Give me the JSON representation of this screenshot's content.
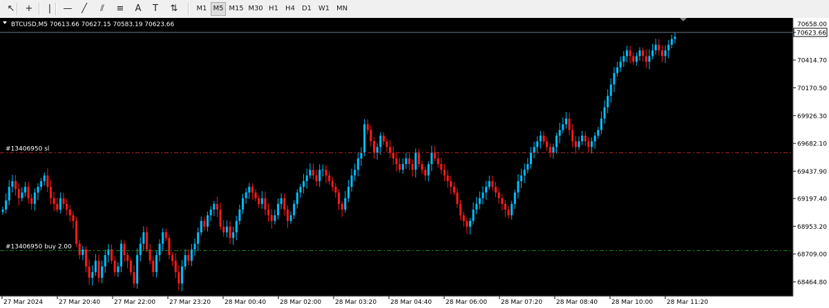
{
  "toolbar": {
    "tools": [
      {
        "name": "cursor-icon",
        "glyph": "↖"
      },
      {
        "name": "crosshair-icon",
        "glyph": "+"
      },
      {
        "name": "vertical-line-icon",
        "glyph": "|"
      },
      {
        "name": "horizontal-line-icon",
        "glyph": "—"
      },
      {
        "name": "trendline-icon",
        "glyph": "╱"
      },
      {
        "name": "equidistant-channel-icon",
        "glyph": "⫽"
      },
      {
        "name": "fibonacci-icon",
        "glyph": "≡"
      },
      {
        "name": "text-icon",
        "glyph": "A"
      },
      {
        "name": "text-label-icon",
        "glyph": "T"
      },
      {
        "name": "arrows-icon",
        "glyph": "⇅"
      }
    ],
    "timeframes": [
      "M1",
      "M5",
      "M15",
      "M30",
      "H1",
      "H4",
      "D1",
      "W1",
      "MN"
    ],
    "active_timeframe": "M5"
  },
  "chart": {
    "info": "BTCUSD,M5  70613.66 70627.15 70583.19 70623.66",
    "symbol": "BTCUSD",
    "timeframe": "M5",
    "current_price_label": "70623.66",
    "top_price_label": "70658.00",
    "sl_label": "#13406950 sl",
    "buy_label": "#13406950 buy 2.00",
    "colors": {
      "background": "#000000",
      "bull": "#00bfff",
      "bear": "#ff1a1a",
      "sl_line": "#b22222",
      "buy_line": "#228b22",
      "grid_text": "#000000",
      "axis_bg": "#ffffff"
    }
  },
  "chart_data": {
    "type": "candlestick",
    "symbol": "BTCUSD",
    "timeframe": "M5",
    "ohlc_last": {
      "open": 70613.66,
      "high": 70627.15,
      "low": 70583.19,
      "close": 70623.66
    },
    "y_ticks": [
      70658.0,
      70414.7,
      70170.5,
      69926.3,
      69682.1,
      69437.9,
      69197.4,
      68953.2,
      68709.0,
      68464.8
    ],
    "y_tick_labels": [
      "70658.00",
      "70414.70",
      "70170.50",
      "69926.30",
      "69682.10",
      "69437.90",
      "69197.40",
      "68953.20",
      "68709.00",
      "68464.80"
    ],
    "x_tick_labels": [
      "27 Mar 2024",
      "27 Mar 20:40",
      "27 Mar 22:00",
      "27 Mar 23:20",
      "28 Mar 00:40",
      "28 Mar 02:00",
      "28 Mar 03:20",
      "28 Mar 04:40",
      "28 Mar 06:00",
      "28 Mar 07:20",
      "28 Mar 08:40",
      "28 Mar 10:00",
      "28 Mar 11:20"
    ],
    "sl_level": 69600,
    "buy_level": 68740,
    "current_price": 70623.66,
    "close_series": [
      69100,
      69180,
      69300,
      69350,
      69280,
      69200,
      69250,
      69300,
      69200,
      69150,
      69250,
      69300,
      69350,
      69400,
      69300,
      69200,
      69150,
      69100,
      69200,
      69150,
      69100,
      69050,
      69000,
      68800,
      68700,
      68750,
      68600,
      68500,
      68550,
      68650,
      68500,
      68600,
      68700,
      68750,
      68650,
      68550,
      68600,
      68800,
      68700,
      68650,
      68550,
      68450,
      68700,
      68800,
      68900,
      68750,
      68650,
      68550,
      68700,
      68800,
      68900,
      68850,
      68700,
      68650,
      68550,
      68450,
      68600,
      68700,
      68650,
      68750,
      68800,
      68900,
      69000,
      68950,
      69050,
      69100,
      69150,
      69100,
      68950,
      68900,
      68950,
      68850,
      68900,
      69000,
      69100,
      69200,
      69250,
      69300,
      69250,
      69200,
      69150,
      69200,
      69100,
      69050,
      69000,
      69050,
      69150,
      69200,
      69100,
      69000,
      69050,
      69150,
      69250,
      69300,
      69350,
      69400,
      69450,
      69400,
      69350,
      69450,
      69450,
      69400,
      69350,
      69300,
      69250,
      69150,
      69100,
      69200,
      69300,
      69400,
      69450,
      69550,
      69600,
      69850,
      69800,
      69700,
      69600,
      69650,
      69750,
      69700,
      69650,
      69600,
      69550,
      69500,
      69450,
      69500,
      69550,
      69500,
      69450,
      69600,
      69500,
      69450,
      69400,
      69500,
      69600,
      69550,
      69500,
      69450,
      69400,
      69350,
      69300,
      69250,
      69150,
      69050,
      69000,
      68950,
      69000,
      69100,
      69150,
      69200,
      69250,
      69300,
      69350,
      69300,
      69250,
      69200,
      69150,
      69100,
      69050,
      69150,
      69250,
      69350,
      69400,
      69450,
      69500,
      69600,
      69650,
      69700,
      69750,
      69700,
      69650,
      69600,
      69650,
      69750,
      69800,
      69850,
      69900,
      69800,
      69700,
      69650,
      69700,
      69750,
      69700,
      69650,
      69700,
      69750,
      69800,
      69900,
      70000,
      70100,
      70200,
      70300,
      70350,
      70400,
      70450,
      70500,
      70450,
      70400,
      70450,
      70500,
      70450,
      70400,
      70450,
      70500,
      70550,
      70500,
      70450,
      70500,
      70550,
      70600,
      70620
    ]
  }
}
